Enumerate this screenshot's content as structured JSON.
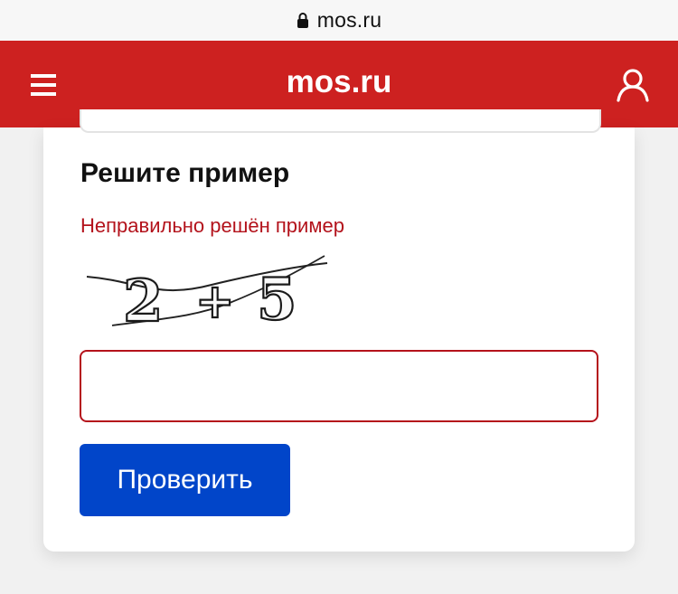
{
  "browser": {
    "url_text": "mos.ru",
    "lock_icon": "lock-icon"
  },
  "header": {
    "title": "mos.ru",
    "background_color": "#cd2120",
    "menu_icon": "hamburger-menu-icon",
    "user_icon": "user-icon"
  },
  "captcha_form": {
    "heading": "Решите пример",
    "error_message": "Неправильно решён пример",
    "error_color": "#b3121b",
    "captcha": {
      "characters": [
        "2",
        "+",
        "5"
      ]
    },
    "answer_input": {
      "value": "",
      "placeholder": ""
    },
    "submit_label": "Проверить",
    "submit_color": "#0145c9"
  }
}
